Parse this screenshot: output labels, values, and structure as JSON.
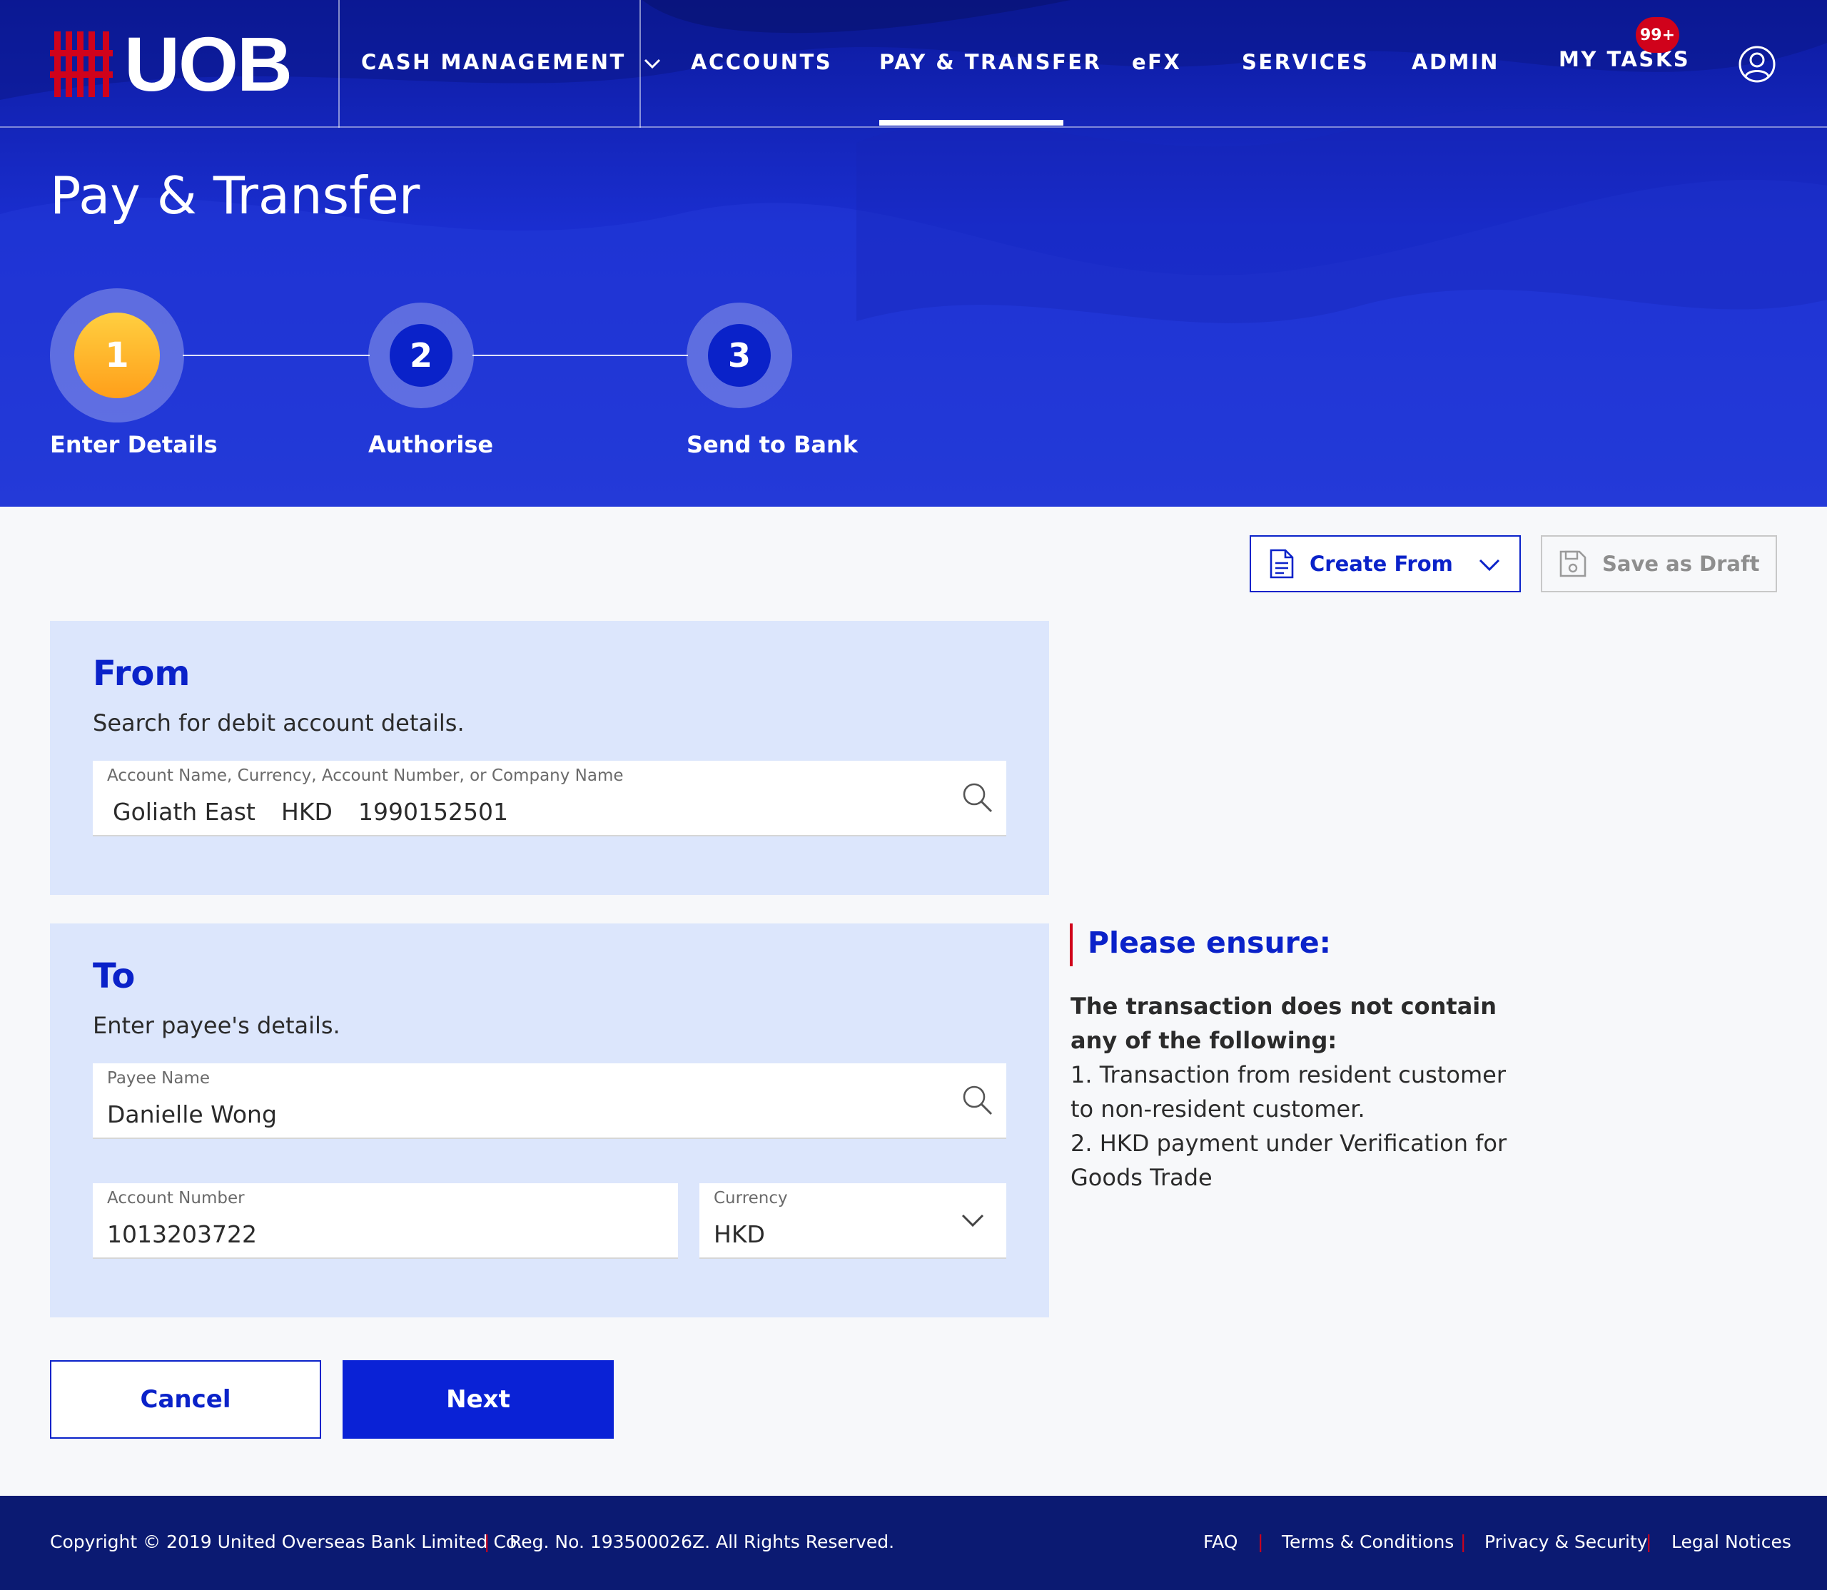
{
  "colors": {
    "brand_blue": "#0a22c9",
    "hero_blue": "#1a2fd0",
    "brand_red": "#d0021b",
    "step_active": "#ffa726",
    "step_inactive": "#0a22c9",
    "footer_bg": "#0b1a72",
    "panel_bg": "#dce6fc"
  },
  "header": {
    "logo_text": "UOB",
    "nav": {
      "cash_management": "CASH MANAGEMENT",
      "accounts": "ACCOUNTS",
      "pay_transfer": "PAY & TRANSFER",
      "efx": "eFX",
      "services": "SERVICES",
      "admin": "ADMIN",
      "my_tasks": "MY TASKS",
      "my_tasks_badge": "99+"
    },
    "active_nav": "PAY & TRANSFER",
    "icons": {
      "cash_management_dropdown": "chevron-down-icon",
      "profile": "user-circle-icon"
    }
  },
  "page": {
    "title": "Pay & Transfer"
  },
  "stepper": {
    "current_step": 1,
    "steps": [
      {
        "number": "1",
        "label": "Enter Details"
      },
      {
        "number": "2",
        "label": "Authorise"
      },
      {
        "number": "3",
        "label": "Send to Bank"
      }
    ]
  },
  "actions": {
    "create_from": "Create From",
    "create_from_icon": "document-icon",
    "save_draft": "Save as Draft",
    "save_draft_icon": "floppy-disk-icon"
  },
  "from": {
    "title": "From",
    "subtitle": "Search for debit account details.",
    "field_label": "Account Name, Currency, Account Number, or Company Name",
    "account_name": "Goliath East",
    "currency": "HKD",
    "account_number": "1990152501"
  },
  "to": {
    "title": "To",
    "subtitle": "Enter payee's details.",
    "payee_label": "Payee Name",
    "payee_value": "Danielle Wong",
    "account_label": "Account Number",
    "account_value": "1013203722",
    "currency_label": "Currency",
    "currency_value": "HKD"
  },
  "notice": {
    "title": "Please ensure:",
    "lead": "The transaction does not contain any of the following:",
    "item1": "1. Transaction from resident customer to non-resident customer.",
    "item2": "2. HKD payment under Verification for Goods Trade"
  },
  "buttons": {
    "cancel": "Cancel",
    "next": "Next"
  },
  "footer": {
    "copyright": "Copyright © 2019 United Overseas Bank Limited Co.",
    "reg": "Reg. No. 193500026Z. All Rights Reserved.",
    "links": {
      "faq": "FAQ",
      "terms": "Terms & Conditions",
      "privacy": "Privacy & Security",
      "legal": "Legal Notices"
    },
    "separator": "|"
  }
}
